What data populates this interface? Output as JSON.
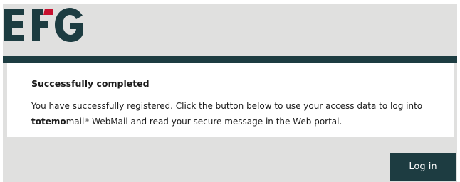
{
  "brand": {
    "logo_text": "EFG",
    "logo_color": "#1d3c41",
    "accent_color": "#c8102e"
  },
  "message": {
    "title": "Successfully completed",
    "body_part1": "You have successfully registered. Click the button below to use your access data to log into",
    "product_bold": "totemo",
    "product_rest": "mail",
    "product_sup": "®",
    "body_part2": " WebMail and read your secure message in the Web portal."
  },
  "actions": {
    "login_label": "Log in"
  },
  "colors": {
    "background": "#e0e0df",
    "dark_teal": "#1d3c41",
    "card": "#ffffff"
  }
}
